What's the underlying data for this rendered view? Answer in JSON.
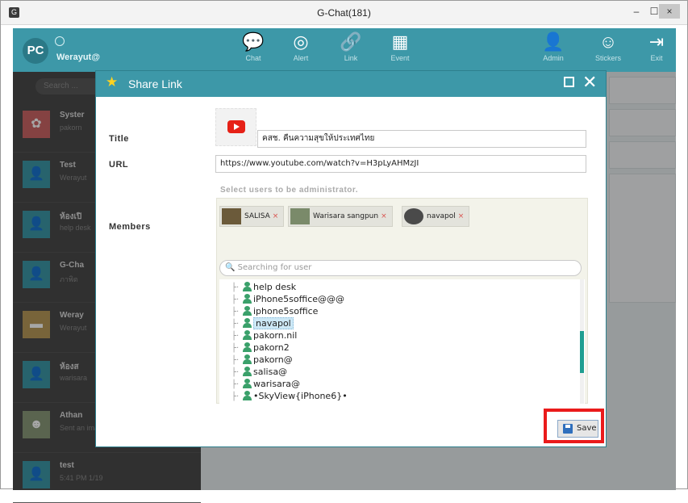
{
  "window": {
    "title": "G-Chat(181)",
    "min": "–",
    "max": "☐",
    "close": "×"
  },
  "header": {
    "avatar_text": "PC",
    "username": "Werayut@",
    "nav": [
      {
        "label": "Chat",
        "icon": "chat-icon"
      },
      {
        "label": "Alert",
        "icon": "globe-icon"
      },
      {
        "label": "Link",
        "icon": "link-icon"
      },
      {
        "label": "Event",
        "icon": "calendar-icon"
      },
      {
        "label": "Admin",
        "icon": "admin-icon"
      },
      {
        "label": "Stickers",
        "icon": "smiley-icon"
      },
      {
        "label": "Exit",
        "icon": "exit-icon"
      }
    ]
  },
  "sidebar": {
    "search_placeholder": "Search ...",
    "chats": [
      {
        "name": "Syster",
        "preview": "pakorn"
      },
      {
        "name": "Test",
        "preview": "Werayut"
      },
      {
        "name": "ห้องเปิ",
        "preview": "help desk"
      },
      {
        "name": "G-Cha",
        "preview": "ภาพิต"
      },
      {
        "name": "Weray",
        "preview": "Werayut"
      },
      {
        "name": "ห้องส",
        "preview": "warisara"
      },
      {
        "name": "Athan",
        "preview": "Sent an image"
      },
      {
        "name": "test",
        "preview": "5:41 PM 1/19"
      }
    ]
  },
  "dialog": {
    "title": "Share Link",
    "title_label": "Title",
    "url_label": "URL",
    "members_label": "Members",
    "title_value": "คสช. คืนความสุขให้ประเทศไทย",
    "url_value": "https://www.youtube.com/watch?v=H3pLyAHMzJI",
    "admin_hint": "Select users to be administrator.",
    "chips": [
      {
        "name": "SALISA"
      },
      {
        "name": "Warisara sangpun"
      },
      {
        "name": "navapol"
      }
    ],
    "chip_remove": "×",
    "user_search_placeholder": "Searching for user",
    "tree": [
      {
        "name": "help desk",
        "selected": false
      },
      {
        "name": "iPhone5soffice@@@",
        "selected": false
      },
      {
        "name": "iphone5soffice",
        "selected": false
      },
      {
        "name": "navapol",
        "selected": true
      },
      {
        "name": "pakorn.nil",
        "selected": false
      },
      {
        "name": "pakorn2",
        "selected": false
      },
      {
        "name": "pakorn@",
        "selected": false
      },
      {
        "name": "salisa@",
        "selected": false
      },
      {
        "name": "warisara@",
        "selected": false
      },
      {
        "name": "•SkyView{iPhone6}•",
        "selected": false
      }
    ],
    "save_label": "Save"
  },
  "colors": {
    "accent": "#3d98a8",
    "highlight": "#ea1b1b",
    "star": "#ffd21f"
  }
}
